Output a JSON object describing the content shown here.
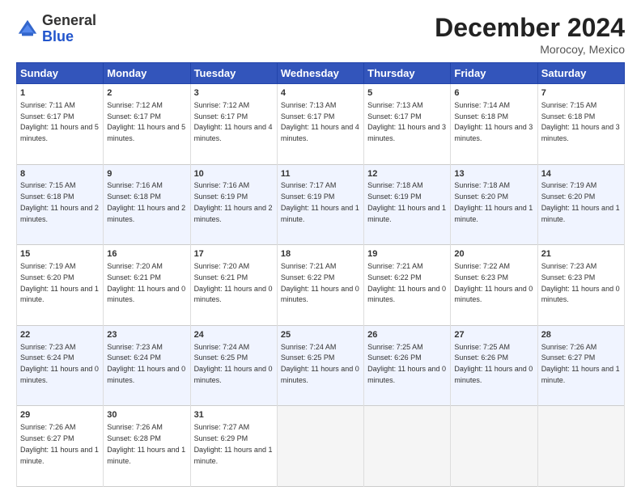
{
  "header": {
    "logo": {
      "general": "General",
      "blue": "Blue"
    },
    "title": "December 2024",
    "location": "Morocoy, Mexico"
  },
  "weekdays": [
    "Sunday",
    "Monday",
    "Tuesday",
    "Wednesday",
    "Thursday",
    "Friday",
    "Saturday"
  ],
  "weeks": [
    [
      {
        "day": 1,
        "sunrise": "7:11 AM",
        "sunset": "6:17 PM",
        "daylight": "11 hours and 5 minutes."
      },
      {
        "day": 2,
        "sunrise": "7:12 AM",
        "sunset": "6:17 PM",
        "daylight": "11 hours and 5 minutes."
      },
      {
        "day": 3,
        "sunrise": "7:12 AM",
        "sunset": "6:17 PM",
        "daylight": "11 hours and 4 minutes."
      },
      {
        "day": 4,
        "sunrise": "7:13 AM",
        "sunset": "6:17 PM",
        "daylight": "11 hours and 4 minutes."
      },
      {
        "day": 5,
        "sunrise": "7:13 AM",
        "sunset": "6:17 PM",
        "daylight": "11 hours and 3 minutes."
      },
      {
        "day": 6,
        "sunrise": "7:14 AM",
        "sunset": "6:18 PM",
        "daylight": "11 hours and 3 minutes."
      },
      {
        "day": 7,
        "sunrise": "7:15 AM",
        "sunset": "6:18 PM",
        "daylight": "11 hours and 3 minutes."
      }
    ],
    [
      {
        "day": 8,
        "sunrise": "7:15 AM",
        "sunset": "6:18 PM",
        "daylight": "11 hours and 2 minutes."
      },
      {
        "day": 9,
        "sunrise": "7:16 AM",
        "sunset": "6:18 PM",
        "daylight": "11 hours and 2 minutes."
      },
      {
        "day": 10,
        "sunrise": "7:16 AM",
        "sunset": "6:19 PM",
        "daylight": "11 hours and 2 minutes."
      },
      {
        "day": 11,
        "sunrise": "7:17 AM",
        "sunset": "6:19 PM",
        "daylight": "11 hours and 1 minute."
      },
      {
        "day": 12,
        "sunrise": "7:18 AM",
        "sunset": "6:19 PM",
        "daylight": "11 hours and 1 minute."
      },
      {
        "day": 13,
        "sunrise": "7:18 AM",
        "sunset": "6:20 PM",
        "daylight": "11 hours and 1 minute."
      },
      {
        "day": 14,
        "sunrise": "7:19 AM",
        "sunset": "6:20 PM",
        "daylight": "11 hours and 1 minute."
      }
    ],
    [
      {
        "day": 15,
        "sunrise": "7:19 AM",
        "sunset": "6:20 PM",
        "daylight": "11 hours and 1 minute."
      },
      {
        "day": 16,
        "sunrise": "7:20 AM",
        "sunset": "6:21 PM",
        "daylight": "11 hours and 0 minutes."
      },
      {
        "day": 17,
        "sunrise": "7:20 AM",
        "sunset": "6:21 PM",
        "daylight": "11 hours and 0 minutes."
      },
      {
        "day": 18,
        "sunrise": "7:21 AM",
        "sunset": "6:22 PM",
        "daylight": "11 hours and 0 minutes."
      },
      {
        "day": 19,
        "sunrise": "7:21 AM",
        "sunset": "6:22 PM",
        "daylight": "11 hours and 0 minutes."
      },
      {
        "day": 20,
        "sunrise": "7:22 AM",
        "sunset": "6:23 PM",
        "daylight": "11 hours and 0 minutes."
      },
      {
        "day": 21,
        "sunrise": "7:23 AM",
        "sunset": "6:23 PM",
        "daylight": "11 hours and 0 minutes."
      }
    ],
    [
      {
        "day": 22,
        "sunrise": "7:23 AM",
        "sunset": "6:24 PM",
        "daylight": "11 hours and 0 minutes."
      },
      {
        "day": 23,
        "sunrise": "7:23 AM",
        "sunset": "6:24 PM",
        "daylight": "11 hours and 0 minutes."
      },
      {
        "day": 24,
        "sunrise": "7:24 AM",
        "sunset": "6:25 PM",
        "daylight": "11 hours and 0 minutes."
      },
      {
        "day": 25,
        "sunrise": "7:24 AM",
        "sunset": "6:25 PM",
        "daylight": "11 hours and 0 minutes."
      },
      {
        "day": 26,
        "sunrise": "7:25 AM",
        "sunset": "6:26 PM",
        "daylight": "11 hours and 0 minutes."
      },
      {
        "day": 27,
        "sunrise": "7:25 AM",
        "sunset": "6:26 PM",
        "daylight": "11 hours and 0 minutes."
      },
      {
        "day": 28,
        "sunrise": "7:26 AM",
        "sunset": "6:27 PM",
        "daylight": "11 hours and 1 minute."
      }
    ],
    [
      {
        "day": 29,
        "sunrise": "7:26 AM",
        "sunset": "6:27 PM",
        "daylight": "11 hours and 1 minute."
      },
      {
        "day": 30,
        "sunrise": "7:26 AM",
        "sunset": "6:28 PM",
        "daylight": "11 hours and 1 minute."
      },
      {
        "day": 31,
        "sunrise": "7:27 AM",
        "sunset": "6:29 PM",
        "daylight": "11 hours and 1 minute."
      },
      null,
      null,
      null,
      null
    ]
  ]
}
